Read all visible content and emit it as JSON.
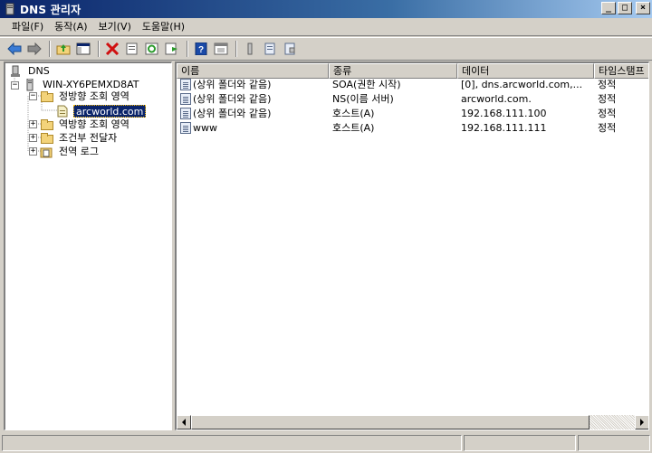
{
  "window": {
    "title": "DNS 관리자",
    "buttons": {
      "minimize": "_",
      "maximize": "□",
      "close": "×"
    }
  },
  "menu": [
    {
      "label": "파일(F)"
    },
    {
      "label": "동작(A)"
    },
    {
      "label": "보기(V)"
    },
    {
      "label": "도움말(H)"
    }
  ],
  "toolbar": {
    "icons": [
      "back-icon",
      "forward-icon",
      "up-folder-icon",
      "show-hide-tree-icon",
      "delete-icon",
      "properties-icon",
      "refresh-icon",
      "export-list-icon",
      "help-icon",
      "console-icon",
      "new-host-icon",
      "new-alias-icon",
      "new-mail-exchanger-icon"
    ]
  },
  "tree": {
    "root": {
      "label": "DNS"
    },
    "server": {
      "label": "WIN-XY6PEMXD8AT",
      "expander": "−"
    },
    "forward": {
      "label": "정방향 조회 영역",
      "expander": "−"
    },
    "zone": {
      "label": "arcworld.com",
      "selected": true
    },
    "reverse": {
      "label": "역방향 조회 영역",
      "expander": "+"
    },
    "conditional": {
      "label": "조건부 전달자",
      "expander": "+"
    },
    "global_logs": {
      "label": "전역 로그",
      "expander": "+"
    }
  },
  "list": {
    "columns": [
      "이름",
      "종류",
      "데이터",
      "타임스탬프"
    ],
    "rows": [
      {
        "name": "(상위 폴더와 같음)",
        "type": "SOA(권한 시작)",
        "data": "[0], dns.arcworld.com,...",
        "timestamp": "정적"
      },
      {
        "name": "(상위 폴더와 같음)",
        "type": "NS(이름 서버)",
        "data": "arcworld.com.",
        "timestamp": "정적"
      },
      {
        "name": "(상위 폴더와 같음)",
        "type": "호스트(A)",
        "data": "192.168.111.100",
        "timestamp": "정적"
      },
      {
        "name": "www",
        "type": "호스트(A)",
        "data": "192.168.111.111",
        "timestamp": "정적"
      }
    ]
  },
  "colors": {
    "titlebar_start": "#0a246a",
    "selection": "#0a246a",
    "face": "#d4d0c8"
  }
}
